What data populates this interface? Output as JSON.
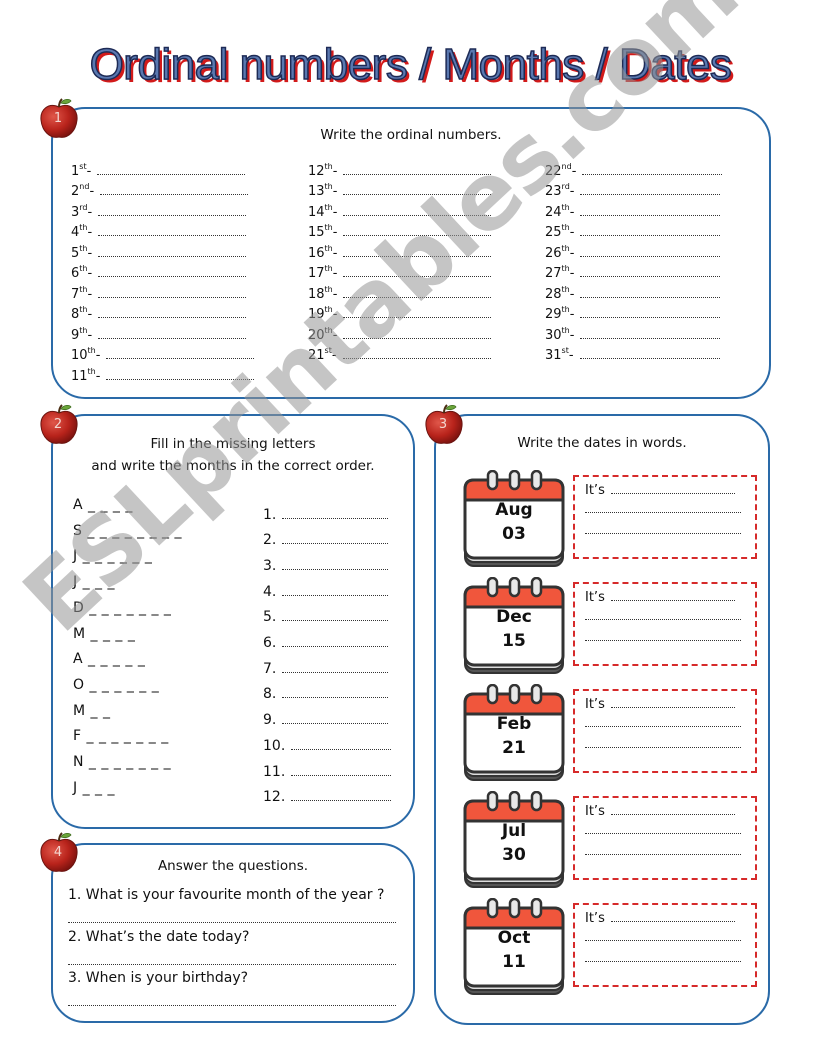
{
  "title": "Ordinal numbers / Months / Dates",
  "section1": {
    "number": "1",
    "instruction": "Write the ordinal numbers.",
    "columns": [
      [
        {
          "n": "1",
          "suf": "st"
        },
        {
          "n": "2",
          "suf": "nd"
        },
        {
          "n": "3",
          "suf": "rd"
        },
        {
          "n": "4",
          "suf": "th"
        },
        {
          "n": "5",
          "suf": "th"
        },
        {
          "n": "6",
          "suf": "th"
        },
        {
          "n": "7",
          "suf": "th"
        },
        {
          "n": "8",
          "suf": "th"
        },
        {
          "n": "9",
          "suf": "th"
        },
        {
          "n": "10",
          "suf": "th"
        },
        {
          "n": "11",
          "suf": "th"
        }
      ],
      [
        {
          "n": "12",
          "suf": "th"
        },
        {
          "n": "13",
          "suf": "th"
        },
        {
          "n": "14",
          "suf": "th"
        },
        {
          "n": "15",
          "suf": "th"
        },
        {
          "n": "16",
          "suf": "th"
        },
        {
          "n": "17",
          "suf": "th"
        },
        {
          "n": "18",
          "suf": "th"
        },
        {
          "n": "19",
          "suf": "th"
        },
        {
          "n": "20",
          "suf": "th"
        },
        {
          "n": "21",
          "suf": "st"
        }
      ],
      [
        {
          "n": "22",
          "suf": "nd"
        },
        {
          "n": "23",
          "suf": "rd"
        },
        {
          "n": "24",
          "suf": "th"
        },
        {
          "n": "25",
          "suf": "th"
        },
        {
          "n": "26",
          "suf": "th"
        },
        {
          "n": "27",
          "suf": "th"
        },
        {
          "n": "28",
          "suf": "th"
        },
        {
          "n": "29",
          "suf": "th"
        },
        {
          "n": "30",
          "suf": "th"
        },
        {
          "n": "31",
          "suf": "st"
        }
      ]
    ],
    "separator": " -"
  },
  "section2": {
    "number": "2",
    "instruction_line1": "Fill in the missing letters",
    "instruction_line2": "and write the months in the correct order.",
    "months": [
      {
        "letter": "A",
        "blanks": "_ _ _ _"
      },
      {
        "letter": "S",
        "blanks": "_ _ _ _ _ _ _ _"
      },
      {
        "letter": "J",
        "blanks": "_ _ _ _ _ _"
      },
      {
        "letter": "J",
        "blanks": "_ _ _"
      },
      {
        "letter": "D",
        "blanks": "_ _ _ _ _ _ _"
      },
      {
        "letter": "M",
        "blanks": "_ _ _ _"
      },
      {
        "letter": "A",
        "blanks": "_ _ _ _ _"
      },
      {
        "letter": "O",
        "blanks": "_ _ _ _ _ _"
      },
      {
        "letter": "M",
        "blanks": "_ _"
      },
      {
        "letter": "F",
        "blanks": "_ _ _ _ _ _ _"
      },
      {
        "letter": "N",
        "blanks": "_ _ _ _ _ _ _"
      },
      {
        "letter": "J",
        "blanks": "_ _ _"
      }
    ],
    "order": [
      "1.",
      "2.",
      "3.",
      "4.",
      "5.",
      "6.",
      "7.",
      "8.",
      "9.",
      "10.",
      "11.",
      "12."
    ]
  },
  "section3": {
    "number": "3",
    "instruction": "Write the dates in words.",
    "answer_prefix": "It’s",
    "dates": [
      {
        "month": "Aug",
        "day": "03"
      },
      {
        "month": "Dec",
        "day": "15"
      },
      {
        "month": "Feb",
        "day": "21"
      },
      {
        "month": "Jul",
        "day": "30"
      },
      {
        "month": "Oct",
        "day": "11"
      }
    ]
  },
  "section4": {
    "number": "4",
    "instruction": "Answer the questions.",
    "questions": [
      "1. What is your favourite month of the year ?",
      "2. What’s the date today?",
      "3. When is your birthday?"
    ]
  },
  "watermark": "ESLprintables.com",
  "colors": {
    "border": "#2a6aa8",
    "apple": "#b8231b",
    "calendar_header": "#f0563c",
    "dashed_box": "#d62a2a",
    "title_fill": "#5a78b0",
    "title_shadow": "#d21a1a"
  }
}
